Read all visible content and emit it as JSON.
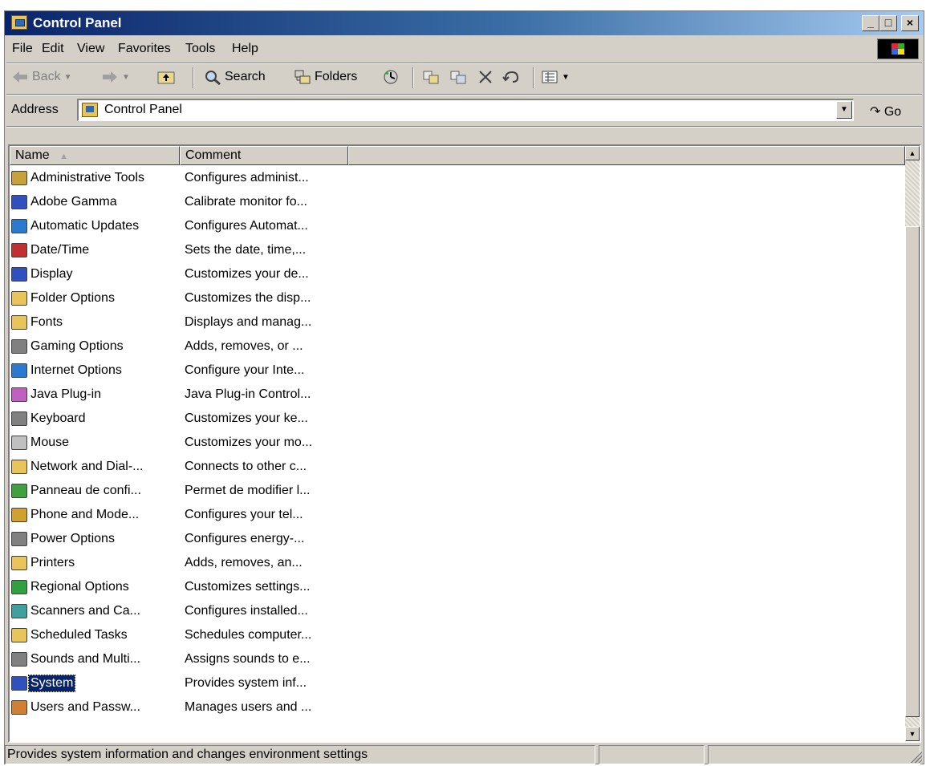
{
  "window": {
    "title": "Control Panel",
    "minimize": "_",
    "maximize": "□",
    "close": "×"
  },
  "menu": [
    "File",
    "Edit",
    "View",
    "Favorites",
    "Tools",
    "Help"
  ],
  "toolbar": {
    "back": "Back",
    "search": "Search",
    "folders": "Folders"
  },
  "address": {
    "label": "Address",
    "value": "Control Panel",
    "go": "Go"
  },
  "columns": {
    "name": "Name",
    "comment": "Comment"
  },
  "items": [
    {
      "name": "Administrative Tools",
      "comment": "Configures administ...",
      "icon": "admin-tools-icon",
      "color": "#c9a13a"
    },
    {
      "name": "Adobe Gamma",
      "comment": "Calibrate monitor fo...",
      "icon": "monitor-icon",
      "color": "#3050c0"
    },
    {
      "name": "Automatic Updates",
      "comment": "Configures Automat...",
      "icon": "globe-update-icon",
      "color": "#2a7ad0"
    },
    {
      "name": "Date/Time",
      "comment": "Sets the date, time,...",
      "icon": "calendar-clock-icon",
      "color": "#c03030"
    },
    {
      "name": "Display",
      "comment": "Customizes your de...",
      "icon": "display-icon",
      "color": "#3050c0"
    },
    {
      "name": "Folder Options",
      "comment": "Customizes the disp...",
      "icon": "folder-icon",
      "color": "#e8c45a"
    },
    {
      "name": "Fonts",
      "comment": "Displays and manag...",
      "icon": "fonts-folder-icon",
      "color": "#e8c45a"
    },
    {
      "name": "Gaming Options",
      "comment": "Adds, removes, or ...",
      "icon": "joystick-icon",
      "color": "#808080"
    },
    {
      "name": "Internet Options",
      "comment": "Configure your Inte...",
      "icon": "internet-globe-icon",
      "color": "#2a7ad0"
    },
    {
      "name": "Java Plug-in",
      "comment": "Java Plug-in Control...",
      "icon": "java-icon",
      "color": "#c060c0"
    },
    {
      "name": "Keyboard",
      "comment": "Customizes your ke...",
      "icon": "keyboard-icon",
      "color": "#808080"
    },
    {
      "name": "Mouse",
      "comment": "Customizes your mo...",
      "icon": "mouse-icon",
      "color": "#c0c0c0"
    },
    {
      "name": "Network and Dial-...",
      "comment": "Connects to other c...",
      "icon": "network-icon",
      "color": "#e8c45a"
    },
    {
      "name": "Panneau de confi...",
      "comment": "Permet de modifier l...",
      "icon": "control-panel-icon",
      "color": "#40a040"
    },
    {
      "name": "Phone and Mode...",
      "comment": "Configures your tel...",
      "icon": "phone-icon",
      "color": "#d0a030"
    },
    {
      "name": "Power Options",
      "comment": "Configures energy-...",
      "icon": "power-icon",
      "color": "#808080"
    },
    {
      "name": "Printers",
      "comment": "Adds, removes, an...",
      "icon": "printers-folder-icon",
      "color": "#e8c45a"
    },
    {
      "name": "Regional Options",
      "comment": "Customizes settings...",
      "icon": "regional-globe-icon",
      "color": "#30a040"
    },
    {
      "name": "Scanners and Ca...",
      "comment": "Configures installed...",
      "icon": "scanner-icon",
      "color": "#40a0a0"
    },
    {
      "name": "Scheduled Tasks",
      "comment": "Schedules computer...",
      "icon": "scheduled-tasks-icon",
      "color": "#e8c45a"
    },
    {
      "name": "Sounds and Multi...",
      "comment": "Assigns sounds to e...",
      "icon": "speaker-icon",
      "color": "#808080"
    },
    {
      "name": "System",
      "comment": "Provides system inf...",
      "icon": "computer-icon",
      "color": "#3050c0",
      "selected": true
    },
    {
      "name": "Users and Passw...",
      "comment": "Manages users and ...",
      "icon": "users-icon",
      "color": "#d08030"
    }
  ],
  "status": {
    "text": "Provides system information and changes environment settings"
  }
}
